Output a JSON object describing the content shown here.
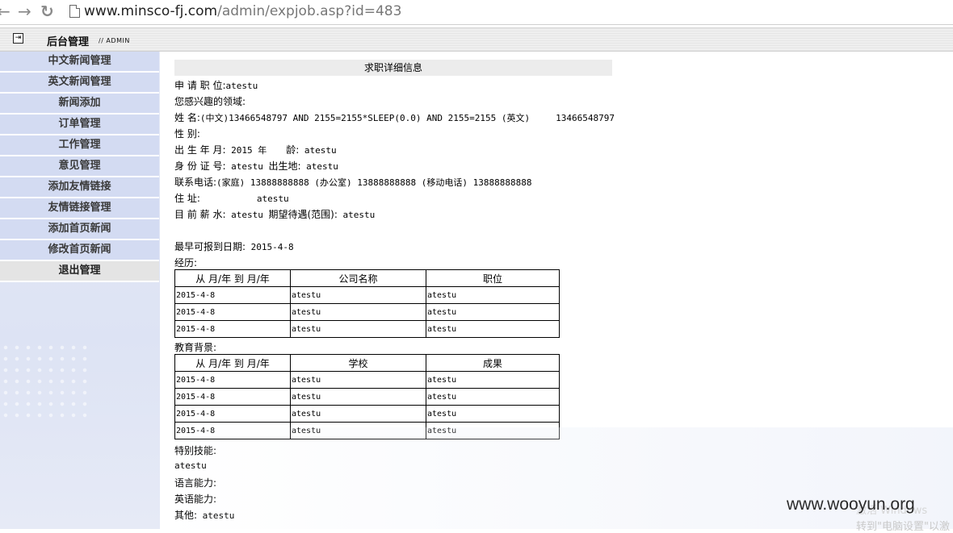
{
  "browser": {
    "url_domain": "www.minsco-fj.com",
    "url_path": "/admin/expjob.asp?id=483"
  },
  "header": {
    "title": "后台管理",
    "subtitle": "// ADMIN"
  },
  "sidebar": {
    "items": [
      {
        "label": "中文新闻管理"
      },
      {
        "label": "英文新闻管理"
      },
      {
        "label": "新闻添加"
      },
      {
        "label": "订单管理"
      },
      {
        "label": "工作管理"
      },
      {
        "label": "意见管理"
      },
      {
        "label": "添加友情链接"
      },
      {
        "label": "友情链接管理"
      },
      {
        "label": "添加首页新闻"
      },
      {
        "label": "修改首页新闻"
      },
      {
        "label": "退出管理"
      }
    ]
  },
  "detail": {
    "title": "求职详细信息",
    "position_label": "申  请  职  位:",
    "position_value": "atestu",
    "interest_label": "您感兴趣的领域:",
    "name_label": "姓  名:",
    "name_value": "(中文)13466548797 AND 2155=2155*SLEEP(0.0) AND 2155=2155 (英文)",
    "name_value2": "13466548797",
    "gender_label": "性  别:",
    "birth_label": "出  生  年  月:",
    "birth_value": "2015 年",
    "age_label": "龄:",
    "age_value": "atestu",
    "id_label": "身  份  证  号:",
    "id_value": "atestu",
    "birthplace_label": "出生地:",
    "birthplace_value": "atestu",
    "phone_label": "联系电话:",
    "phone_value": "(家庭) 13888888888 (办公室) 13888888888 (移动电话) 13888888888",
    "address_label": "住     址:",
    "address_value": "atestu",
    "salary_label": "目  前  薪  水:",
    "salary_value": "atestu",
    "expect_label": "期望待遇(范围):",
    "expect_value": "atestu",
    "start_label": "最早可报到日期:",
    "start_value": "2015-4-8",
    "experience_label": "经历:",
    "experience_headers": [
      "从 月/年 到 月/年",
      "公司名称",
      "职位"
    ],
    "experience_rows": [
      [
        "2015-4-8",
        "atestu",
        "atestu"
      ],
      [
        "2015-4-8",
        "atestu",
        "atestu"
      ],
      [
        "2015-4-8",
        "atestu",
        "atestu"
      ]
    ],
    "education_label": "教育背景:",
    "education_headers": [
      "从 月/年 到 月/年",
      "学校",
      "成果"
    ],
    "education_rows": [
      [
        "2015-4-8",
        "atestu",
        "atestu"
      ],
      [
        "2015-4-8",
        "atestu",
        "atestu"
      ],
      [
        "2015-4-8",
        "atestu",
        "atestu"
      ],
      [
        "2015-4-8",
        "atestu",
        "atestu"
      ]
    ],
    "skills_label": "特别技能:",
    "skills_value": "atestu",
    "language_label": "语言能力:",
    "english_label": "英语能力:",
    "other_label": "其他:",
    "other_value": "atestu"
  },
  "watermark": "www.wooyun.org",
  "overlay_ghost_1": "激活 Windows",
  "overlay_ghost_2": "转到\"电脑设置\"以激"
}
